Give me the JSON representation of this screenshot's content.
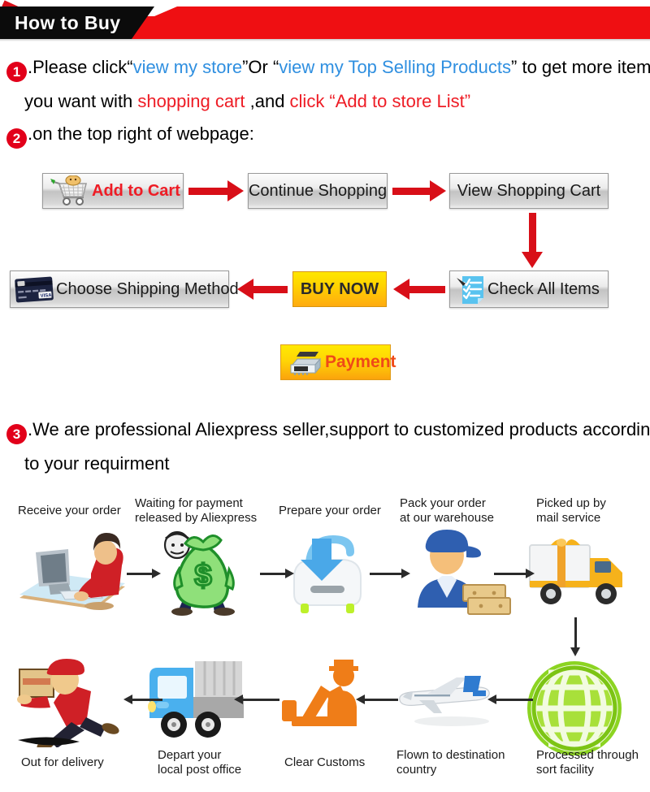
{
  "banner": {
    "title": "How to Buy",
    "black": "#0b0b0b",
    "red": "#ef0f12"
  },
  "steps": {
    "one": {
      "number": "1",
      "line1_part1": ".Please click“",
      "line1_link1": "view my store",
      "line1_part2": "”Or “",
      "line1_link2": "view my Top Selling Products",
      "line1_part3": "” to get more item",
      "line2_part1": "you want with ",
      "line2_red1": "shopping cart",
      "line2_part2": " ,and ",
      "line2_red2": "click “Add to store List”"
    },
    "two": {
      "number": "2",
      "text": ".on the top right of webpage:"
    },
    "three": {
      "number": "3",
      "line1": ".We are professional Aliexpress seller,support to customized products accordin",
      "line2": "to your requirment"
    }
  },
  "buttons": {
    "add_to_cart": "Add to Cart",
    "continue_shopping": "Continue Shopping",
    "view_shopping_cart": "View Shopping Cart",
    "check_all_items": "Check All Items",
    "buy_now": "BUY NOW",
    "choose_shipping_method": "Choose Shipping Method",
    "payment": "Payment"
  },
  "button_icons": {
    "add_to_cart": "shopping-cart-icon",
    "check_all_items": "checklist-clipboard-icon",
    "choose_shipping_method": "credit-card-icon",
    "payment": "cash-register-icon"
  },
  "accent_colors": {
    "red_arrow": "#d80f18",
    "link_blue": "#2f8fe0",
    "highlight_red": "#ee1c25",
    "gold_button": "#ffd400",
    "dark_arrow": "#2b2b2b"
  },
  "process_flow": {
    "top_row": [
      {
        "label": "Receive your order",
        "icon": "person-at-computer-icon"
      },
      {
        "label": "Waiting for payment\nreleased by Aliexpress",
        "icon": "money-bag-icon"
      },
      {
        "label": "Prepare your order",
        "icon": "download-box-icon"
      },
      {
        "label": "Pack your order\nat our warehouse",
        "icon": "warehouse-worker-icon"
      },
      {
        "label": "Picked up by\nmail service",
        "icon": "delivery-truck-gift-icon"
      }
    ],
    "bottom_row": [
      {
        "label": "Out for delivery",
        "icon": "running-courier-icon"
      },
      {
        "label": "Depart your\nlocal post office",
        "icon": "post-truck-icon"
      },
      {
        "label": "Clear Customs",
        "icon": "customs-officer-icon"
      },
      {
        "label": "Flown to destination\ncountry",
        "icon": "airplane-icon"
      },
      {
        "label": "Processed through\nsort facility",
        "icon": "green-globe-icon"
      }
    ]
  }
}
